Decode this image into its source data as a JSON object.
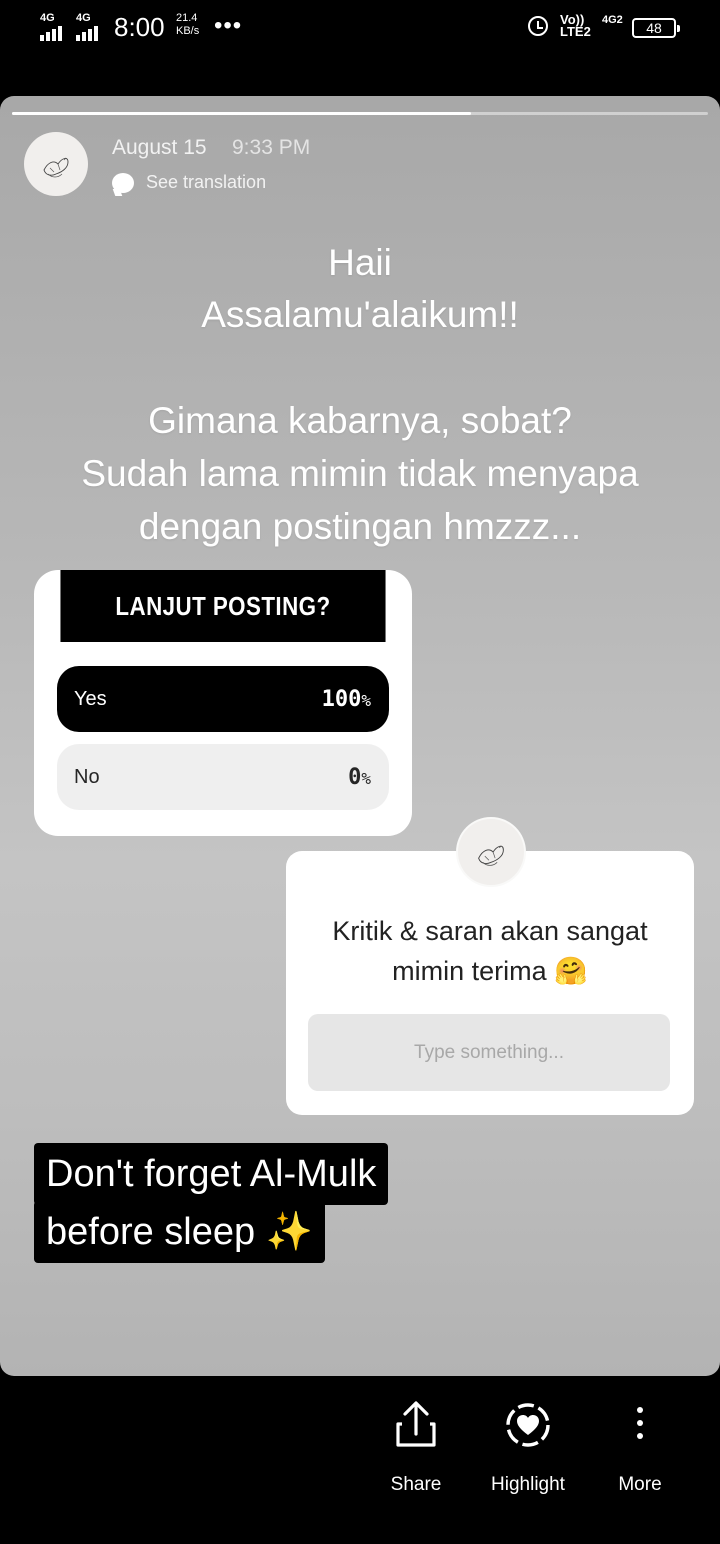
{
  "status_bar": {
    "network1": "4G",
    "network2": "4G",
    "time": "8:00",
    "speed_value": "21.4",
    "speed_unit": "KB/s",
    "more_dots": "•••",
    "volte_top": "Vo))",
    "volte_bottom": "LTE2",
    "network3": "4G2",
    "battery": "48"
  },
  "story": {
    "progress": 0.66,
    "date": "August 15",
    "time": "9:33 PM",
    "see_translation": "See translation",
    "caption": [
      "Haii",
      "Assalamu'alaikum!!",
      "Gimana kabarnya, sobat?",
      "Sudah lama mimin tidak menyapa",
      "dengan postingan hmzzz..."
    ],
    "poll": {
      "question": "LANJUT POSTING?",
      "options": [
        {
          "label": "Yes",
          "percent": "100",
          "unit": "%"
        },
        {
          "label": "No",
          "percent": "0",
          "unit": "%"
        }
      ]
    },
    "question_box": {
      "line1": "Kritik & saran akan sangat",
      "line2": "mimin terima 🤗",
      "placeholder": "Type something..."
    },
    "text_sticker": {
      "line1": "Don't forget Al-Mulk",
      "line2": "before sleep ✨"
    }
  },
  "actions": [
    {
      "label": "Share",
      "icon": "share-icon"
    },
    {
      "label": "Highlight",
      "icon": "highlight-heart-icon"
    },
    {
      "label": "More",
      "icon": "more-vertical-icon"
    }
  ]
}
